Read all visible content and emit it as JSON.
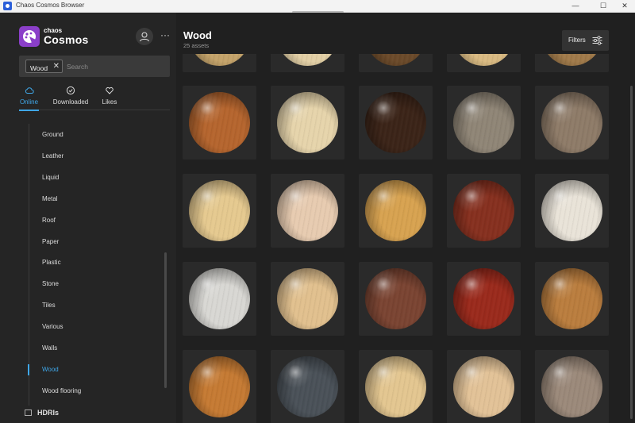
{
  "window": {
    "title": "Chaos Cosmos Browser",
    "minimize": "—",
    "maximize": "☐",
    "close": "✕"
  },
  "brand": {
    "small": "chaos",
    "big": "Cosmos"
  },
  "header": {
    "more": "···"
  },
  "search": {
    "tag": "Wood",
    "tag_remove": "✕",
    "placeholder": "Search"
  },
  "tabs": [
    {
      "label": "Online",
      "icon": "cloud-icon",
      "active": true
    },
    {
      "label": "Downloaded",
      "icon": "check-circle-icon",
      "active": false
    },
    {
      "label": "Likes",
      "icon": "heart-icon",
      "active": false
    }
  ],
  "categories": [
    {
      "label": "Ground"
    },
    {
      "label": "Leather"
    },
    {
      "label": "Liquid"
    },
    {
      "label": "Metal"
    },
    {
      "label": "Roof"
    },
    {
      "label": "Paper"
    },
    {
      "label": "Plastic"
    },
    {
      "label": "Stone"
    },
    {
      "label": "Tiles"
    },
    {
      "label": "Various"
    },
    {
      "label": "Walls"
    },
    {
      "label": "Wood",
      "active": true
    },
    {
      "label": "Wood flooring"
    }
  ],
  "next_section": {
    "label": "HDRIs",
    "icon": "image-icon"
  },
  "main": {
    "title": "Wood",
    "count": "25 assets",
    "filters_label": "Filters"
  },
  "colors": {
    "accent": "#3fa7e8",
    "brand": "#8b3fc9"
  },
  "materials": [
    [
      "#c4a36a",
      "#e2cfa5",
      "#6b4a2a",
      "#d9ba82",
      "#a07a4a"
    ],
    [
      "#b5652e",
      "#e6d4ab",
      "#3b2418",
      "#8f8576",
      "#8e7b68"
    ],
    [
      "#e5c98f",
      "#e7cbb0",
      "#d7a250",
      "#86301f",
      "#e9e3d8"
    ],
    [
      "#d8d7d3",
      "#e1c08e",
      "#7a4432",
      "#9a2a1c",
      "#ba7d3e"
    ],
    [
      "#c57a33",
      "#4a5158",
      "#e3c690",
      "#e2c297",
      "#9b897a"
    ]
  ]
}
